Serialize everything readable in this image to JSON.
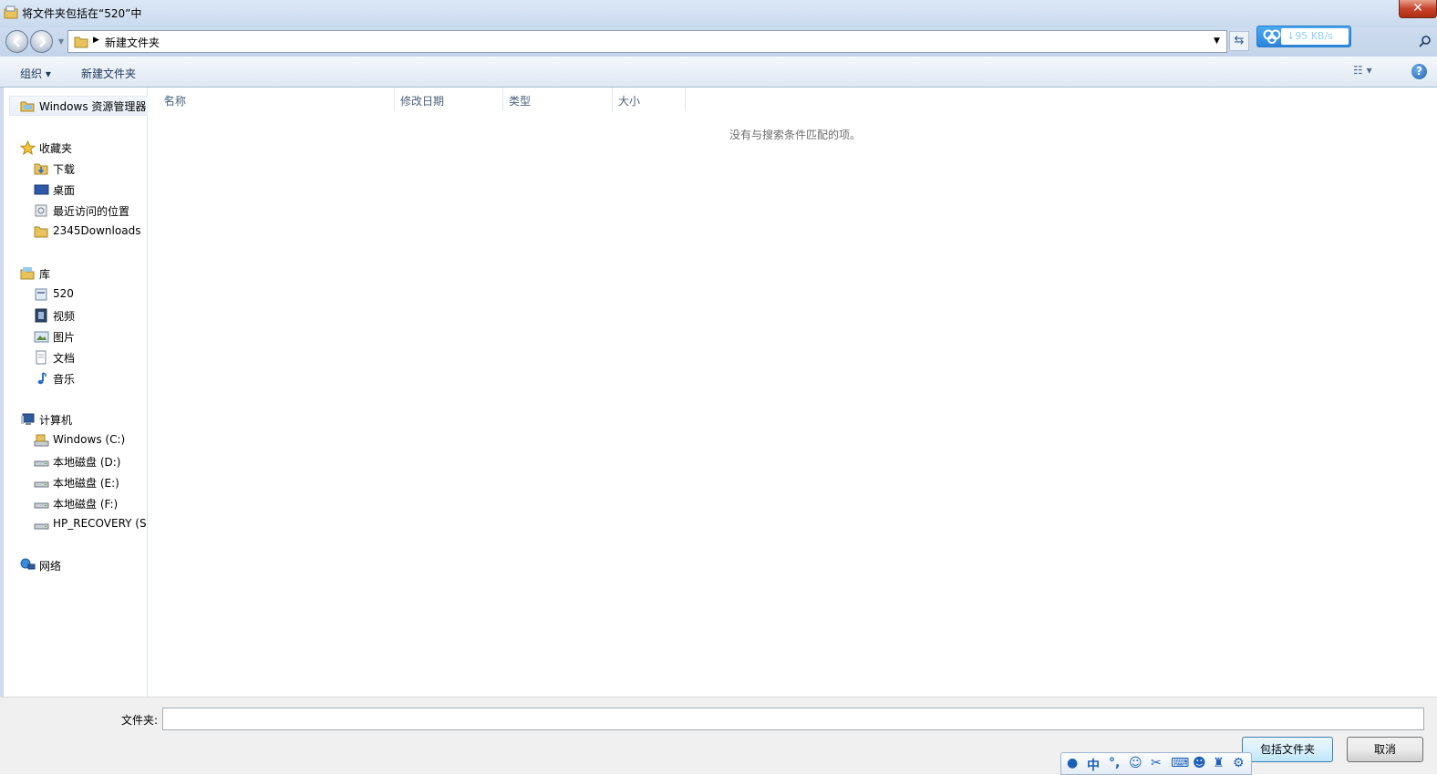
{
  "window": {
    "title": "将文件夹包括在“520”中",
    "close_label": "✕"
  },
  "address_bar": {
    "path_segment": "新建文件夹"
  },
  "baidu_widget": {
    "speed": "↓95 KB/s"
  },
  "toolbar": {
    "organize_label": "组织 ▾",
    "new_folder_label": "新建文件夹",
    "help_label": "?"
  },
  "sidebar": {
    "root": "Windows 资源管理器",
    "favorites": {
      "label": "收藏夹",
      "items": [
        "下载",
        "桌面",
        "最近访问的位置",
        "2345Downloads"
      ]
    },
    "libraries": {
      "label": "库",
      "items": [
        "520",
        "视频",
        "图片",
        "文档",
        "音乐"
      ]
    },
    "computer": {
      "label": "计算机",
      "items": [
        "Windows  (C:)",
        "本地磁盘 (D:)",
        "本地磁盘 (E:)",
        "本地磁盘 (F:)",
        "HP_RECOVERY (S:)"
      ]
    },
    "network": {
      "label": "网络"
    }
  },
  "file_list": {
    "columns": [
      "名称",
      "修改日期",
      "类型",
      "大小"
    ],
    "empty_message": "没有与搜索条件匹配的项。"
  },
  "footer": {
    "folder_label": "文件夹:",
    "folder_value": "",
    "include_button": "包括文件夹",
    "cancel_button": "取消"
  },
  "ime_bar": {
    "mode_label": "中"
  },
  "colors": {
    "accent": "#3c7fb1",
    "close": "#c7432a"
  }
}
